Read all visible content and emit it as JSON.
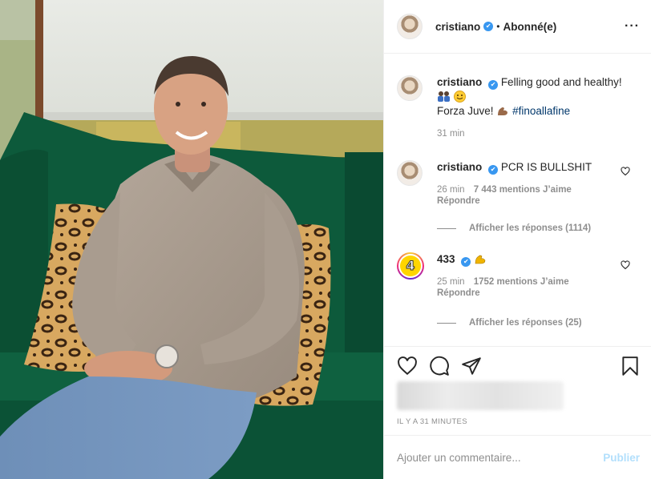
{
  "post": {
    "author": "cristiano",
    "verified_glyph": "✔",
    "separator": "•",
    "follow_status": "Abonné(e)",
    "more_glyph": "···"
  },
  "caption": {
    "user": "cristiano",
    "line1": "Felling good and healthy!",
    "line3_text": "Forza Juve!",
    "hashtag": "#finoallafine",
    "time": "31 min"
  },
  "comments": [
    {
      "user": "cristiano",
      "text": "PCR IS BULLSHIT",
      "time": "26 min",
      "likes": "7 443 mentions J’aime",
      "reply": "Répondre",
      "view_replies": "Afficher les réponses (1114)"
    },
    {
      "user": "433",
      "avatar_label": "4",
      "time": "25 min",
      "likes": "1752 mentions J’aime",
      "reply": "Répondre",
      "view_replies": "Afficher les réponses (25)"
    }
  ],
  "footer": {
    "posted_ago": "IL Y A 31 MINUTES",
    "comment_placeholder": "Ajouter un commentaire...",
    "publish_label": "Publier"
  },
  "icons": [
    "more-options-icon",
    "heart-icon",
    "comment-icon",
    "share-icon",
    "bookmark-icon",
    "verified-badge-icon",
    "muscle-emoji-icon",
    "smile-emoji-icon",
    "people-emoji-icon"
  ],
  "colors": {
    "verified_blue": "#3897f0",
    "hashtag_blue": "#00376b",
    "publish_disabled": "#b2dffc",
    "muted_text": "#8e8e8e",
    "sofa_green": "#0e5a3c"
  }
}
